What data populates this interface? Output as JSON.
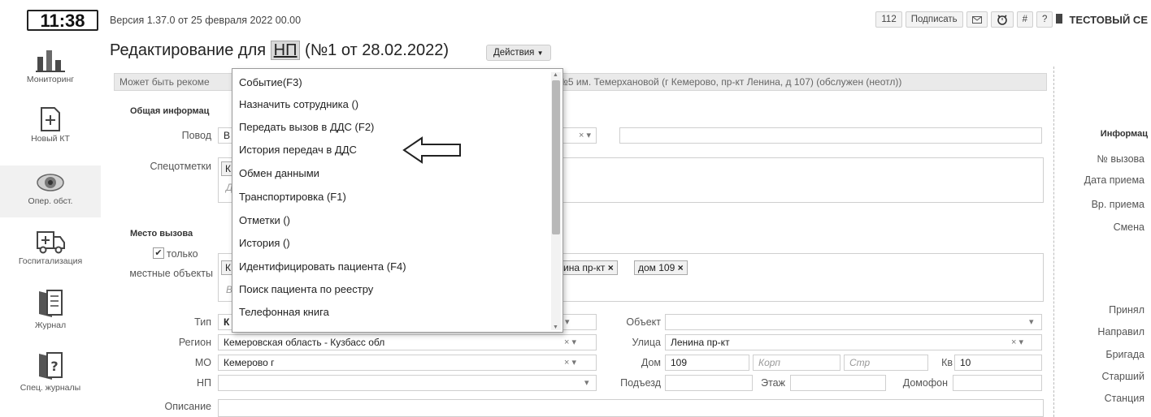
{
  "clock": "11:38",
  "version": "Версия 1.37.0 от 25 февраля 2022 00.00",
  "topbar": {
    "count": "112",
    "sign": "Подписать",
    "mail_icon": "mail-icon",
    "hash": "#",
    "help": "?",
    "server": "ТЕСТОВЫЙ СЕ"
  },
  "sidebar": {
    "items": [
      {
        "label": "Мониторинг",
        "icon": "chart-icon"
      },
      {
        "label": "Новый КТ",
        "icon": "new-document-icon"
      },
      {
        "label": "Опер. обст.",
        "icon": "eye-icon"
      },
      {
        "label": "Госпитализация",
        "icon": "ambulance-icon"
      },
      {
        "label": "Журнал",
        "icon": "journal-icon"
      },
      {
        "label": "Спец. журналы",
        "icon": "question-book-icon"
      }
    ]
  },
  "title": {
    "prefix": "Редактирование для",
    "np": "НП",
    "suffix": "(№1 от 28.02.2022)",
    "actions": "Действия"
  },
  "recommendation": {
    "start": "Может быть рекоме",
    "tail": "№5 им. Темерхановой (г Кемерово, пр-кт Ленина, д 107) (обслужен (неотл))"
  },
  "form": {
    "general_info": "Общая информац",
    "reason_label": "Повод",
    "reason_value": "В",
    "special_marks_label": "Спецотметки",
    "special_marks_value": "К",
    "special_marks_placeholder": "Д",
    "call_place": "Место вызова",
    "only_label_1": "только",
    "only_label_2": "местные объекты",
    "tag_prefix": "К",
    "tag_placeholder": "В",
    "tag_street": "ина пр-кт",
    "tag_house": "дом 109",
    "type_label": "Тип",
    "type_value": "К",
    "object_label": "Объект",
    "region_label": "Регион",
    "region_value": "Кемеровская область - Кузбасс обл",
    "street_label": "Улица",
    "street_value": "Ленина пр-кт",
    "mo_label": "МО",
    "mo_value": "Кемерово г",
    "house_label": "Дом",
    "house_value": "109",
    "korp_placeholder": "Корп",
    "str_placeholder": "Стр",
    "kv_label": "Кв",
    "kv_value": "10",
    "np_label": "НП",
    "entrance_label": "Подъезд",
    "floor_label": "Этаж",
    "intercom_label": "Домофон",
    "description_label": "Описание"
  },
  "right_panel": {
    "info": "Информац",
    "call_no": "№ вызова",
    "accept_date": "Дата приема",
    "accept_time": "Вр. приема",
    "shift": "Смена",
    "accepted": "Принял",
    "sent": "Направил",
    "brigade": "Бригада",
    "senior": "Старший",
    "station": "Станция"
  },
  "menu": {
    "items": [
      "Событие(F3)",
      "Назначить сотрудника ()",
      "Передать вызов в ДДС (F2)",
      "История передач в ДДС",
      "Обмен данными",
      "Транспортировка (F1)",
      "Отметки ()",
      "История ()",
      "Идентифицировать пациента (F4)",
      "Поиск пациента по реестру",
      "Телефонная книга"
    ]
  }
}
